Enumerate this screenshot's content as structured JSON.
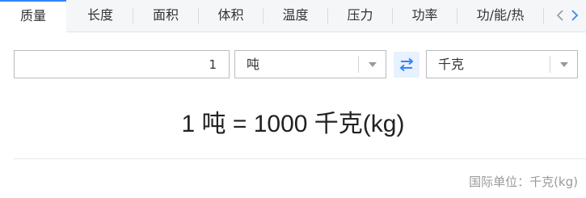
{
  "tabs": [
    {
      "label": "质量",
      "active": true
    },
    {
      "label": "长度",
      "active": false
    },
    {
      "label": "面积",
      "active": false
    },
    {
      "label": "体积",
      "active": false
    },
    {
      "label": "温度",
      "active": false
    },
    {
      "label": "压力",
      "active": false
    },
    {
      "label": "功率",
      "active": false
    },
    {
      "label": "功/能/热",
      "active": false
    }
  ],
  "converter": {
    "input_value": "1",
    "from_unit": "吨",
    "to_unit": "千克"
  },
  "result": {
    "text": "1 吨 = 1000 千克(kg)"
  },
  "footer": {
    "si_unit_note": "国际单位：千克(kg)"
  },
  "colors": {
    "accent": "#3385ff",
    "swap_bg": "#e8f1ff",
    "muted_text": "#999999"
  },
  "icons": {
    "prev": "chevron-left-icon",
    "next": "chevron-right-icon",
    "swap": "swap-arrows-icon",
    "caret": "caret-down-icon"
  }
}
